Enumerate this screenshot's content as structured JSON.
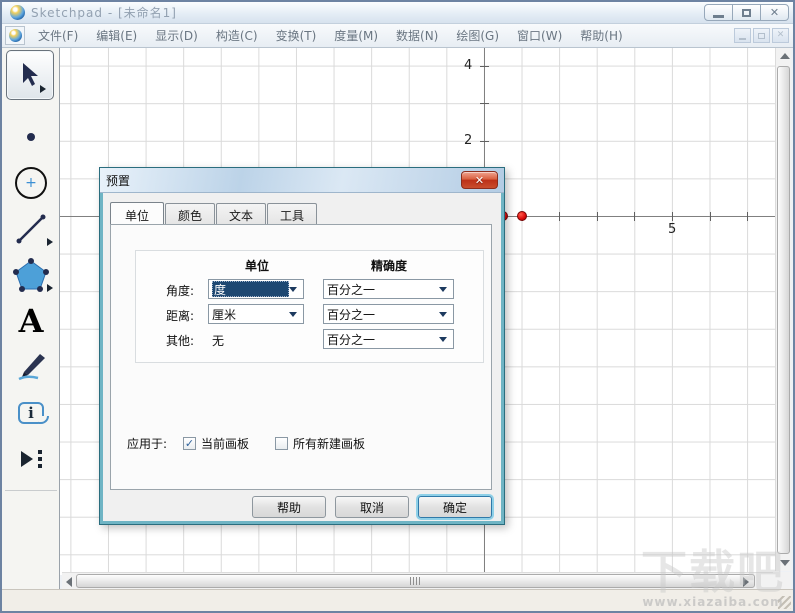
{
  "window": {
    "title": "Sketchpad - [未命名1]",
    "controls": {
      "minimize": "minimize",
      "maximize": "maximize",
      "close": "✕"
    }
  },
  "menu": {
    "items": [
      {
        "label": "文件(F)"
      },
      {
        "label": "编辑(E)"
      },
      {
        "label": "显示(D)"
      },
      {
        "label": "构造(C)"
      },
      {
        "label": "变换(T)"
      },
      {
        "label": "度量(M)"
      },
      {
        "label": "数据(N)"
      },
      {
        "label": "绘图(G)"
      },
      {
        "label": "窗口(W)"
      },
      {
        "label": "帮助(H)"
      }
    ],
    "mdi_close": "✕"
  },
  "toolbar": {
    "tools": [
      {
        "name": "selection-arrow-tool"
      },
      {
        "name": "point-tool"
      },
      {
        "name": "compass-tool"
      },
      {
        "name": "straightedge-tool"
      },
      {
        "name": "polygon-tool"
      },
      {
        "name": "text-tool"
      },
      {
        "name": "marker-tool"
      },
      {
        "name": "information-tool"
      },
      {
        "name": "custom-tool"
      }
    ],
    "text_tool_glyph": "A"
  },
  "canvas": {
    "y_axis_labels": [
      {
        "text": "4"
      },
      {
        "text": "2"
      }
    ],
    "x_axis_labels": [
      {
        "text": "5"
      }
    ]
  },
  "dialog": {
    "title": "预置",
    "close_glyph": "✕",
    "tabs": [
      {
        "label": "单位"
      },
      {
        "label": "颜色"
      },
      {
        "label": "文本"
      },
      {
        "label": "工具"
      }
    ],
    "columns": {
      "unit": "单位",
      "precision": "精确度"
    },
    "rows": [
      {
        "label": "角度:",
        "unit": "度",
        "precision": "百分之一"
      },
      {
        "label": "距离:",
        "unit": "厘米",
        "precision": "百分之一"
      },
      {
        "label": "其他:",
        "unit": "无",
        "precision": "百分之一"
      }
    ],
    "apply_to": {
      "label": "应用于:",
      "options": [
        {
          "label": "当前画板",
          "checked": true
        },
        {
          "label": "所有新建画板",
          "checked": false
        }
      ]
    },
    "check_glyph": "✓",
    "buttons": [
      {
        "label": "帮助"
      },
      {
        "label": "取消"
      },
      {
        "label": "确定"
      }
    ]
  },
  "watermark": {
    "brand": "下载吧",
    "url": "www.xiazaiba.com"
  },
  "colors": {
    "dialog_frame": "#6fb4c4",
    "selection_highlight": "#1d4872",
    "point_red": "#dd0b0b",
    "close_button_red": "#bc3018"
  }
}
